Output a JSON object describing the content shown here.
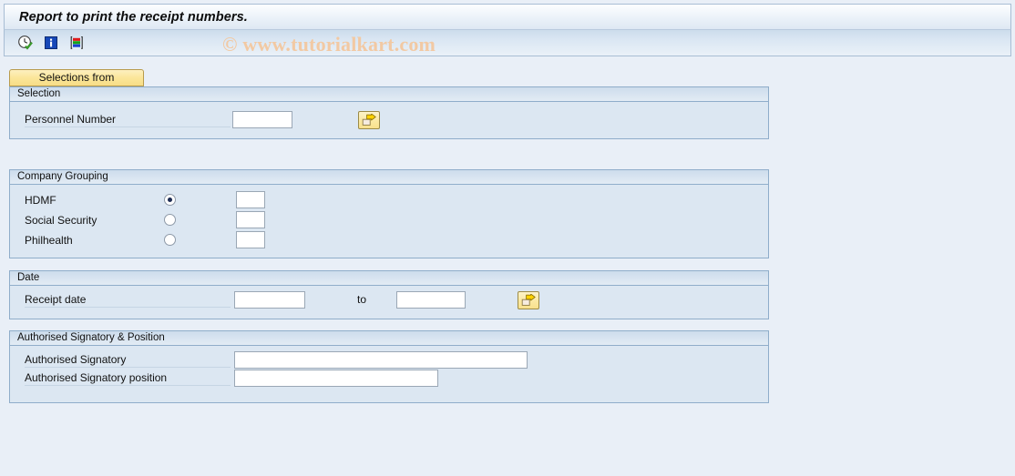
{
  "window": {
    "title": "Report to print the receipt numbers.",
    "watermark": "© www.tutorialkart.com"
  },
  "toolbar": {
    "buttons": [
      {
        "name": "execute-icon",
        "tooltip": "Execute"
      },
      {
        "name": "info-icon",
        "tooltip": "Information"
      },
      {
        "name": "variant-icon",
        "tooltip": "Get Variant"
      }
    ]
  },
  "tabs": [
    {
      "label": "Selections from",
      "selected": true
    }
  ],
  "panels": {
    "selection": {
      "header": "Selection",
      "personnel_number": {
        "label": "Personnel Number",
        "value": "",
        "multi_select_label": "⇒"
      }
    },
    "company_grouping": {
      "header": "Company Grouping",
      "options": [
        {
          "label": "HDMF",
          "selected": true,
          "value": ""
        },
        {
          "label": "Social Security",
          "selected": false,
          "value": ""
        },
        {
          "label": "Philhealth",
          "selected": false,
          "value": ""
        }
      ]
    },
    "date": {
      "header": "Date",
      "receipt_date": {
        "label": "Receipt date",
        "from_value": "",
        "to_label": "to",
        "to_value": "",
        "multi_select_label": "⇒"
      }
    },
    "signatory": {
      "header": "Authorised Signatory & Position",
      "fields": [
        {
          "label": "Authorised Signatory",
          "value": ""
        },
        {
          "label": "Authorised Signatory position",
          "value": ""
        }
      ]
    }
  },
  "colors": {
    "page_background": "#e9eff7",
    "panel_background": "#dce7f2",
    "panel_border": "#8fadca",
    "tab_accent": "#f7dd86",
    "watermark": "#f2c9a3",
    "radio_dot": "#1b2a52"
  }
}
